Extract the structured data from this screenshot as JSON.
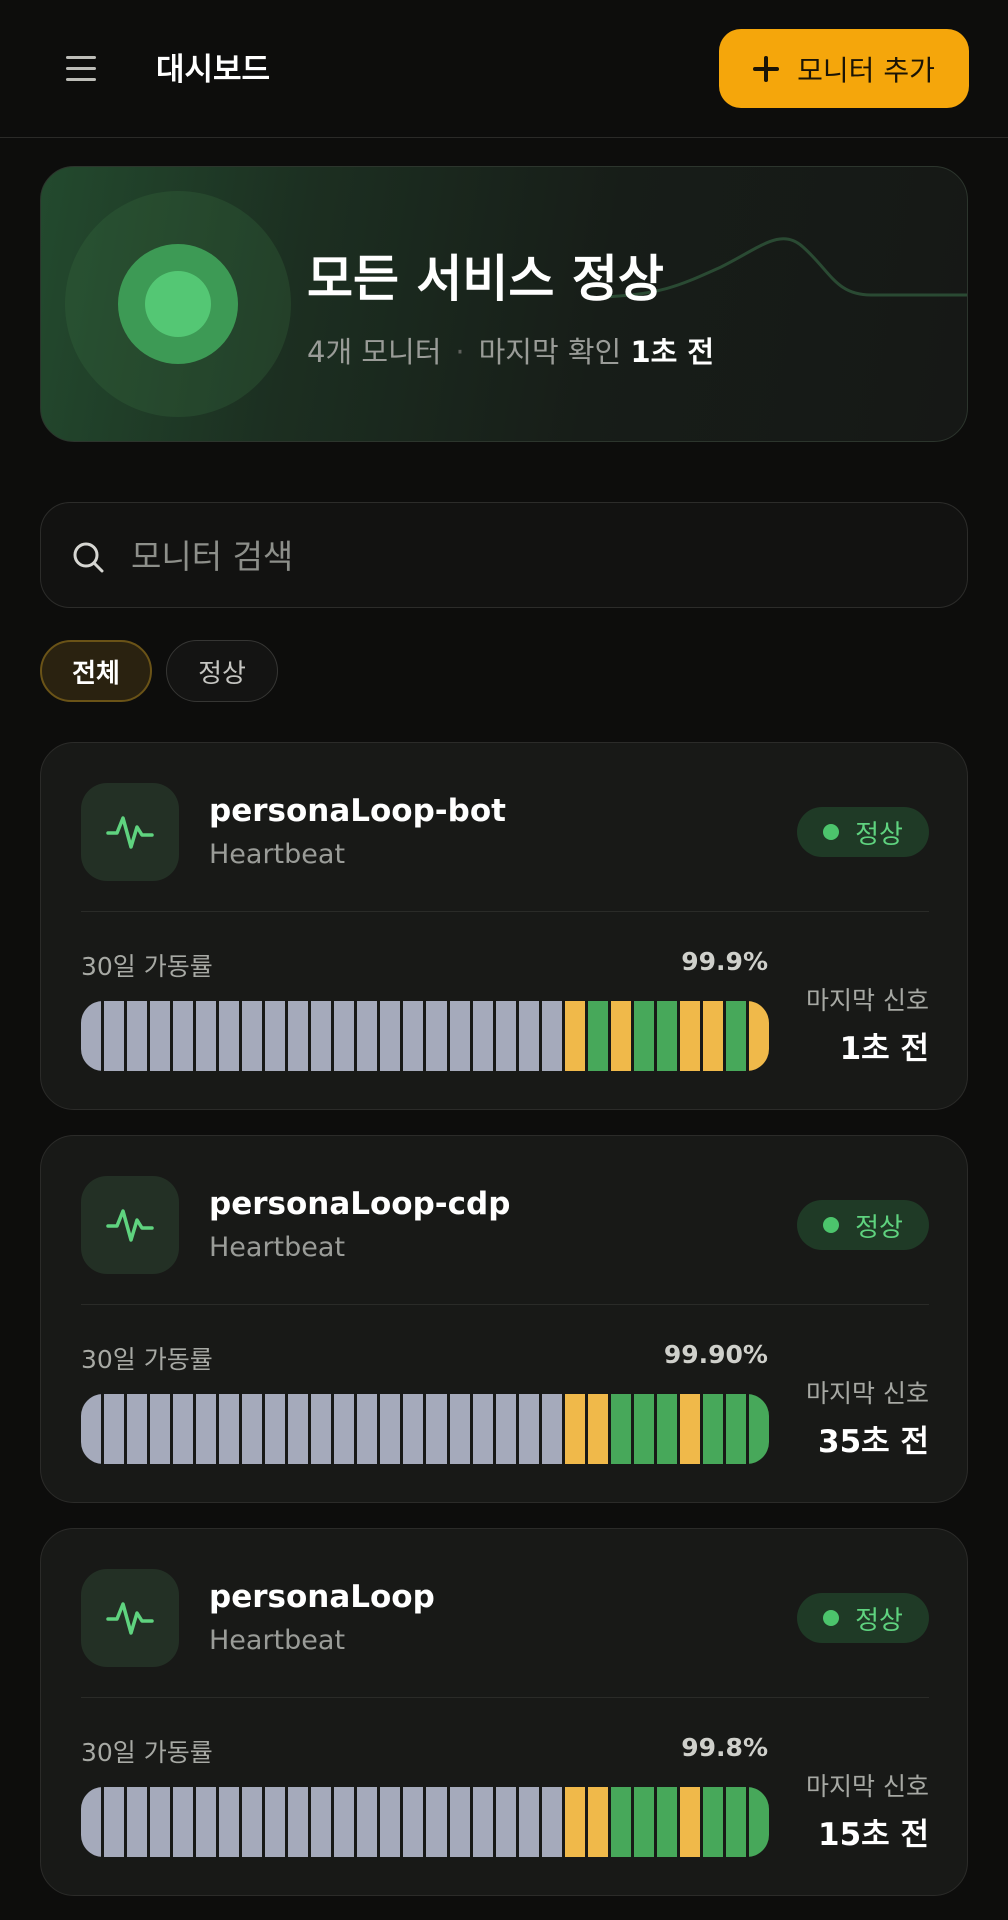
{
  "header": {
    "title": "대시보드",
    "add_button_label": "모니터 추가"
  },
  "status": {
    "title": "모든 서비스 정상",
    "monitor_count": "4개 모니터",
    "separator": "·",
    "last_checked_label": "마지막 확인",
    "last_checked_value": "1초 전",
    "accent_color": "#54c774"
  },
  "search": {
    "placeholder": "모니터 검색",
    "value": ""
  },
  "filters": [
    {
      "label": "전체",
      "selected": true
    },
    {
      "label": "정상",
      "selected": false
    }
  ],
  "monitors": [
    {
      "name": "personaLoop-bot",
      "type": "Heartbeat",
      "status": "정상",
      "uptime_label": "30일 가동률",
      "uptime": "99.9%",
      "last_signal_label": "마지막 신호",
      "last_signal": "1초 전",
      "days": [
        "gray",
        "gray",
        "gray",
        "gray",
        "gray",
        "gray",
        "gray",
        "gray",
        "gray",
        "gray",
        "gray",
        "gray",
        "gray",
        "gray",
        "gray",
        "gray",
        "gray",
        "gray",
        "gray",
        "gray",
        "gray",
        "yellow",
        "green",
        "yellow",
        "green",
        "green",
        "yellow",
        "yellow",
        "green",
        "yellow"
      ]
    },
    {
      "name": "personaLoop-cdp",
      "type": "Heartbeat",
      "status": "정상",
      "uptime_label": "30일 가동률",
      "uptime": "99.90%",
      "last_signal_label": "마지막 신호",
      "last_signal": "35초 전",
      "days": [
        "gray",
        "gray",
        "gray",
        "gray",
        "gray",
        "gray",
        "gray",
        "gray",
        "gray",
        "gray",
        "gray",
        "gray",
        "gray",
        "gray",
        "gray",
        "gray",
        "gray",
        "gray",
        "gray",
        "gray",
        "gray",
        "yellow",
        "yellow",
        "green",
        "green",
        "green",
        "yellow",
        "green",
        "green",
        "green"
      ]
    },
    {
      "name": "personaLoop",
      "type": "Heartbeat",
      "status": "정상",
      "uptime_label": "30일 가동률",
      "uptime": "99.8%",
      "last_signal_label": "마지막 신호",
      "last_signal": "15초 전",
      "days": [
        "gray",
        "gray",
        "gray",
        "gray",
        "gray",
        "gray",
        "gray",
        "gray",
        "gray",
        "gray",
        "gray",
        "gray",
        "gray",
        "gray",
        "gray",
        "gray",
        "gray",
        "gray",
        "gray",
        "gray",
        "gray",
        "yellow",
        "yellow",
        "green",
        "green",
        "green",
        "yellow",
        "green",
        "green",
        "green"
      ]
    }
  ]
}
